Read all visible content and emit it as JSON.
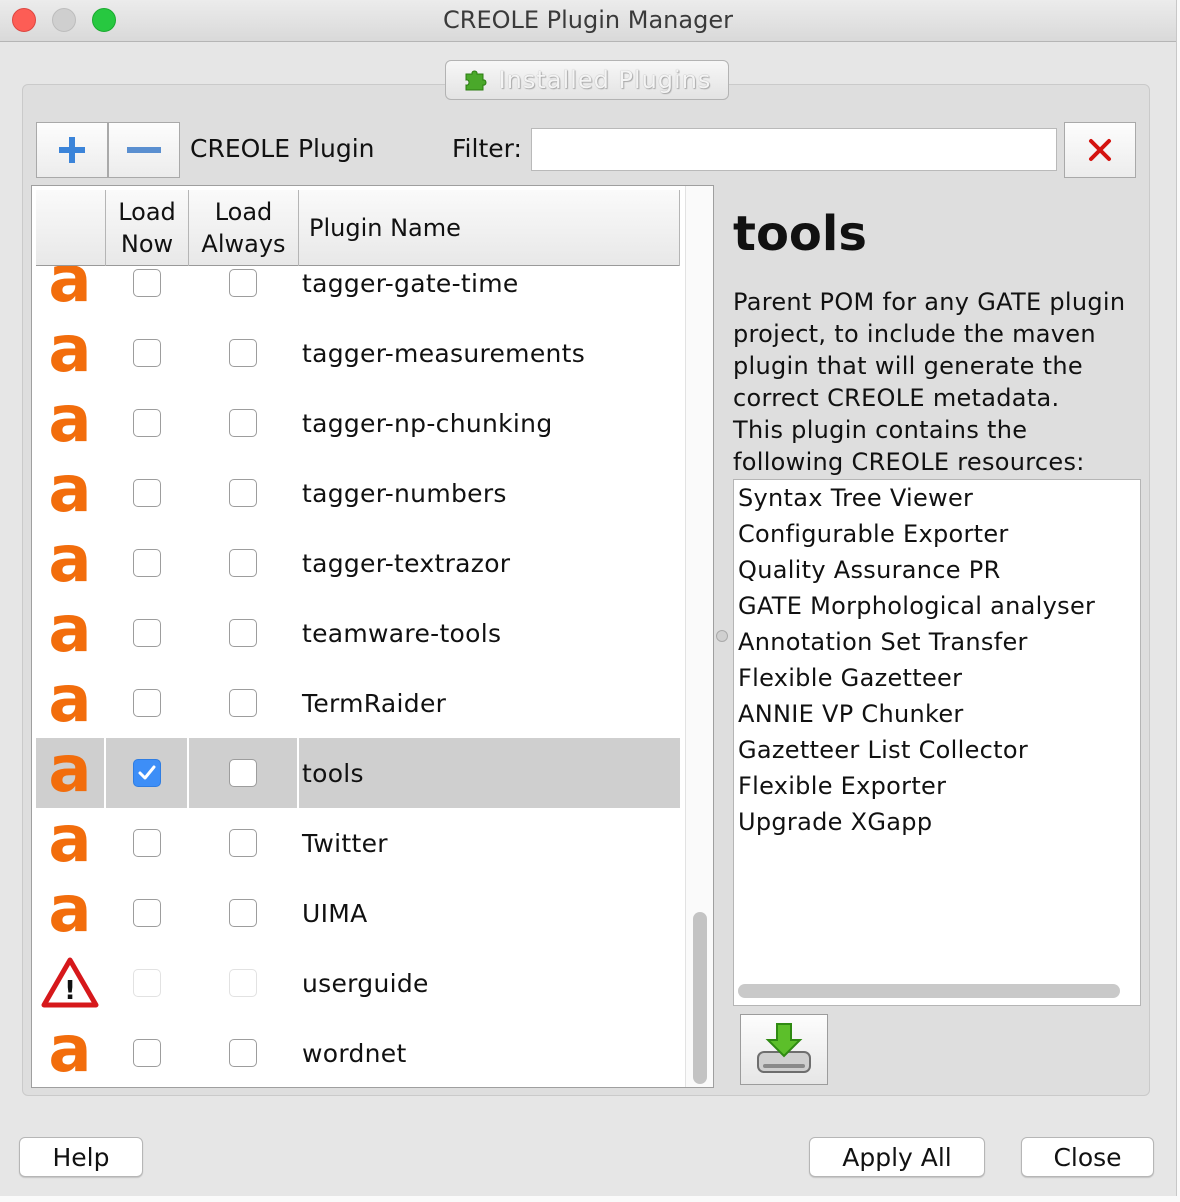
{
  "window": {
    "title": "CREOLE Plugin Manager"
  },
  "tab": {
    "label": "Installed Plugins",
    "icon": "puzzle-icon"
  },
  "toolbar": {
    "add_icon": "plus-icon",
    "remove_icon": "minus-icon",
    "plugin_label": "CREOLE Plugin",
    "filter_label": "Filter:",
    "filter_value": "",
    "clear_icon": "clear-x-icon"
  },
  "table": {
    "columns": [
      "",
      "Load Now",
      "Load Always",
      "Plugin Name"
    ],
    "column_lines": {
      "load_now": [
        "Load",
        "Now"
      ],
      "load_always": [
        "Load",
        "Always"
      ],
      "name": "Plugin Name"
    },
    "rows": [
      {
        "icon": "gate-logo",
        "name": "tagger-gate-time",
        "load_now": false,
        "load_always": false,
        "selected": false,
        "disabled": false
      },
      {
        "icon": "gate-logo",
        "name": "tagger-measurements",
        "load_now": false,
        "load_always": false,
        "selected": false,
        "disabled": false
      },
      {
        "icon": "gate-logo",
        "name": "tagger-np-chunking",
        "load_now": false,
        "load_always": false,
        "selected": false,
        "disabled": false
      },
      {
        "icon": "gate-logo",
        "name": "tagger-numbers",
        "load_now": false,
        "load_always": false,
        "selected": false,
        "disabled": false
      },
      {
        "icon": "gate-logo",
        "name": "tagger-textrazor",
        "load_now": false,
        "load_always": false,
        "selected": false,
        "disabled": false
      },
      {
        "icon": "gate-logo",
        "name": "teamware-tools",
        "load_now": false,
        "load_always": false,
        "selected": false,
        "disabled": false
      },
      {
        "icon": "gate-logo",
        "name": "TermRaider",
        "load_now": false,
        "load_always": false,
        "selected": false,
        "disabled": false
      },
      {
        "icon": "gate-logo",
        "name": "tools",
        "load_now": true,
        "load_always": false,
        "selected": true,
        "disabled": false
      },
      {
        "icon": "gate-logo",
        "name": "Twitter",
        "load_now": false,
        "load_always": false,
        "selected": false,
        "disabled": false
      },
      {
        "icon": "gate-logo",
        "name": "UIMA",
        "load_now": false,
        "load_always": false,
        "selected": false,
        "disabled": false
      },
      {
        "icon": "warning-icon",
        "name": "userguide",
        "load_now": false,
        "load_always": false,
        "selected": false,
        "disabled": true
      },
      {
        "icon": "gate-logo",
        "name": "wordnet",
        "load_now": false,
        "load_always": false,
        "selected": false,
        "disabled": false
      }
    ],
    "logo_glyph": "a",
    "warning_glyph": "!"
  },
  "details": {
    "title": "tools",
    "description_lines": [
      "Parent POM for any GATE plugin",
      "project, to include the maven",
      "plugin that will generate the",
      "correct CREOLE metadata.",
      "This plugin contains the",
      "following CREOLE resources:"
    ],
    "resources": [
      "Syntax Tree Viewer",
      "Configurable Exporter",
      "Quality Assurance PR",
      "GATE Morphological analyser",
      "Annotation Set Transfer",
      "Flexible Gazetteer",
      "ANNIE VP Chunker",
      "Gazetteer List Collector",
      "Flexible Exporter",
      "Upgrade XGapp"
    ],
    "install_icon": "download-disk-icon"
  },
  "buttons": {
    "help": "Help",
    "apply_all": "Apply All",
    "close": "Close"
  },
  "colors": {
    "accent": "#3d8ef7",
    "gate_orange": "#f26d0c",
    "clear_red": "#d4130f",
    "selected_row": "#cfcfcf"
  }
}
